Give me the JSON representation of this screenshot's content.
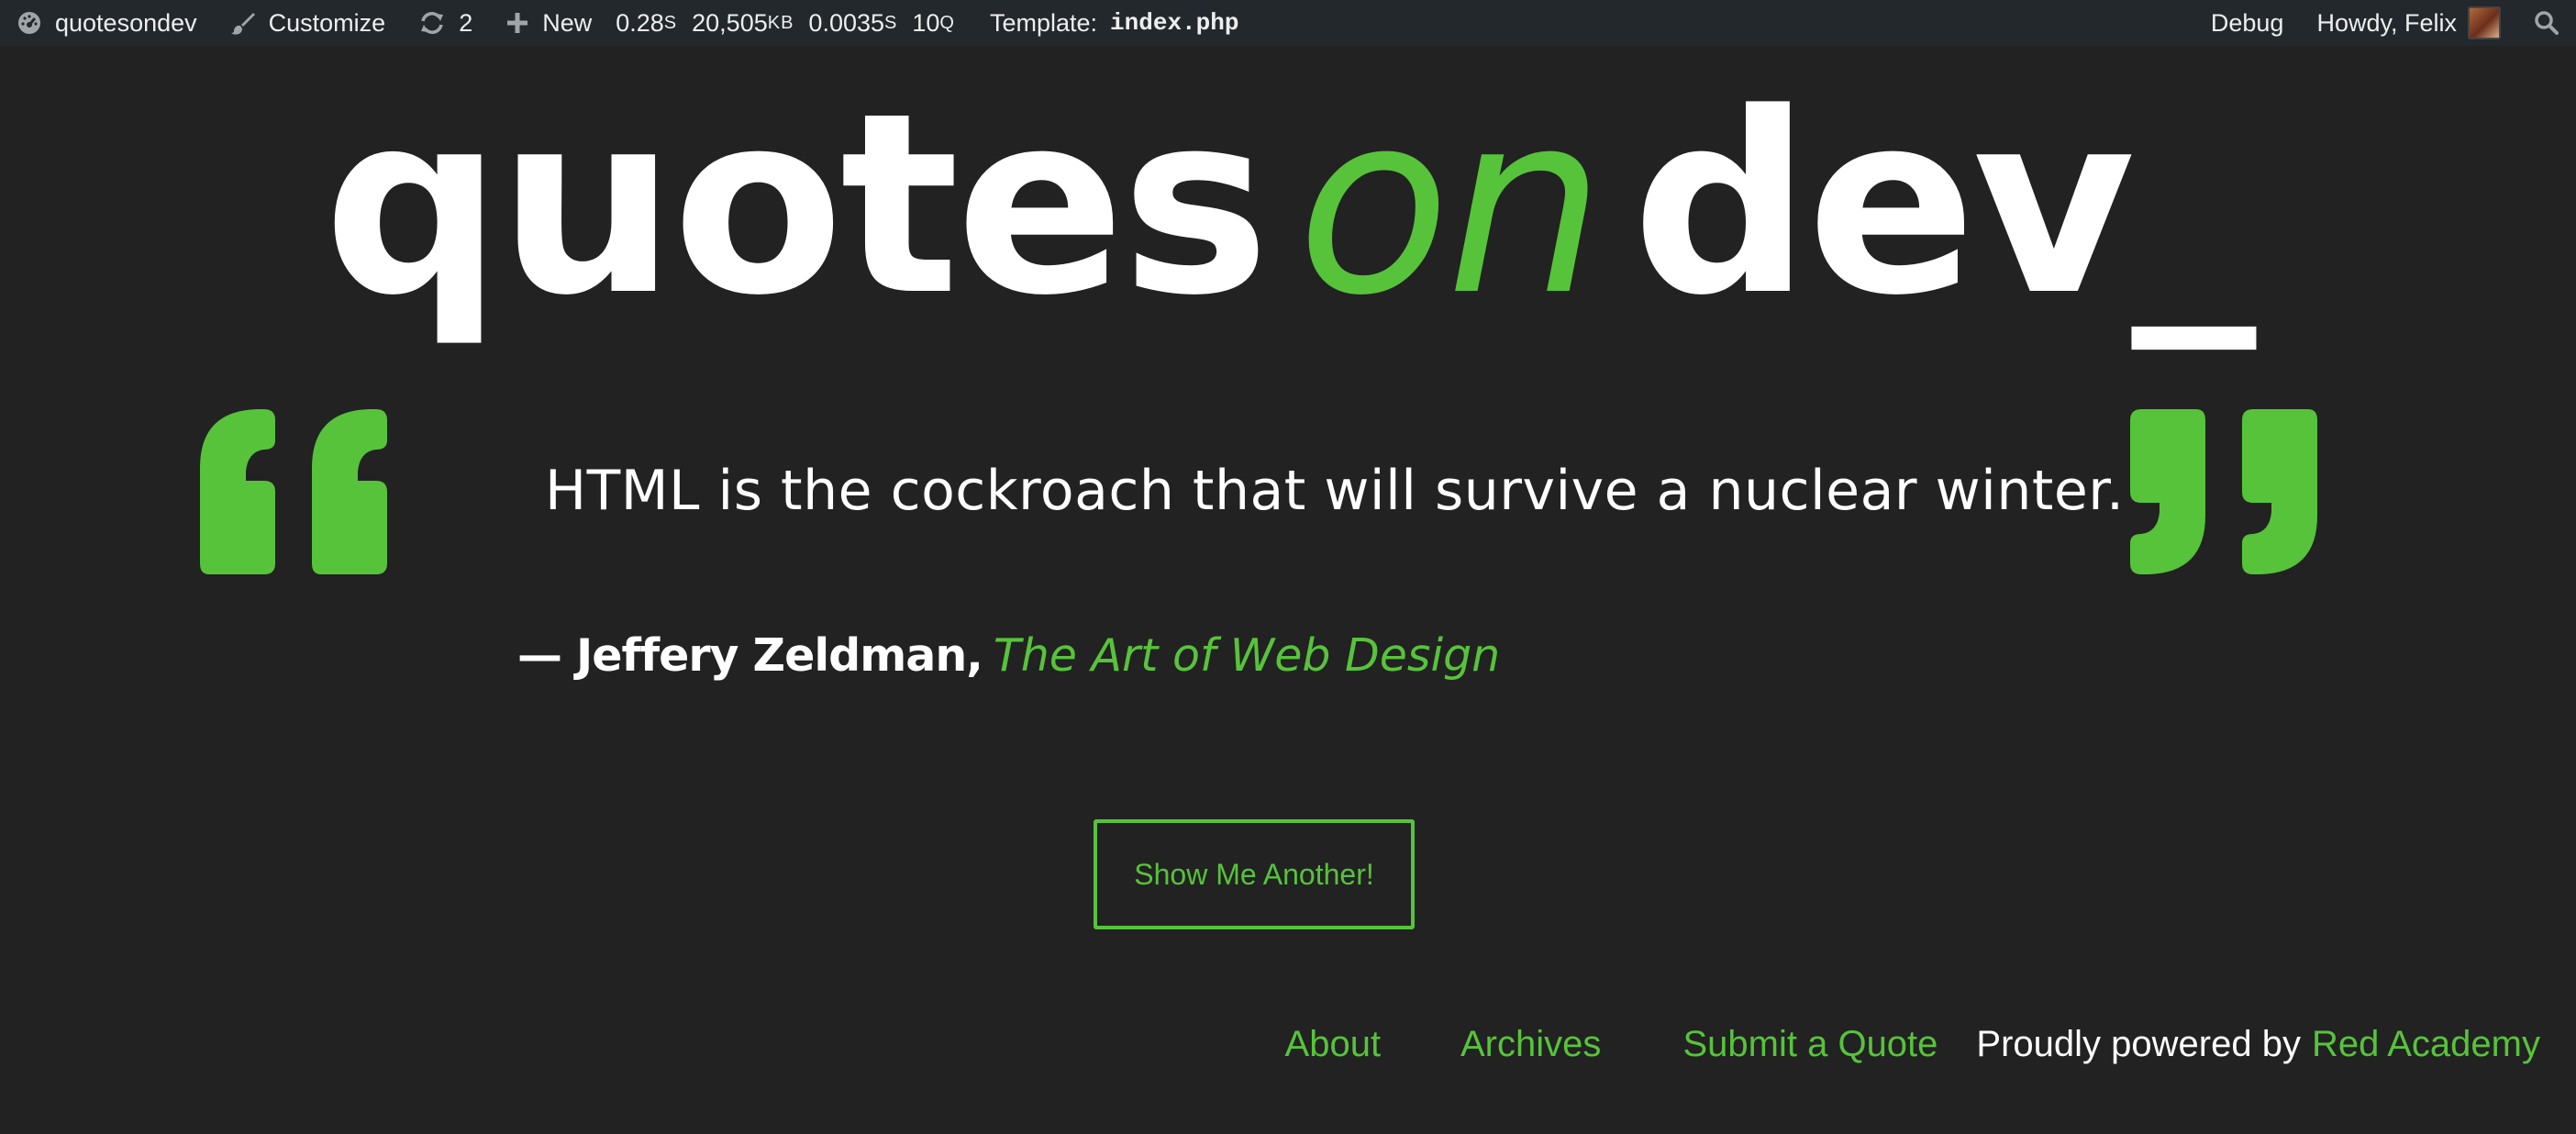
{
  "adminbar": {
    "site_name": "quotesondev",
    "customize_label": "Customize",
    "updates_count": "2",
    "new_label": "New",
    "stats": {
      "time_value": "0.28",
      "time_unit": "S",
      "memory_value": "20,505",
      "memory_unit": "KB",
      "query_time_value": "0.0035",
      "query_time_unit": "S",
      "queries_value": "10",
      "queries_unit": "Q"
    },
    "template_label": "Template:",
    "template_file": "index.php",
    "debug_label": "Debug",
    "greeting": "Howdy, Felix",
    "icons": [
      "dashboard-icon",
      "paintbrush-icon",
      "refresh-icon",
      "plus-icon",
      "search-icon"
    ]
  },
  "logo": {
    "word1": "quotes",
    "word2": "on",
    "word3": "dev_"
  },
  "quote": {
    "text": "HTML is the cockroach that will survive a nuclear winter.",
    "author": "— Jeffery Zeldman,",
    "source": "The Art of Web Design"
  },
  "button": {
    "label": "Show Me Another!"
  },
  "footer": {
    "nav": [
      "About",
      "Archives",
      "Submit a Quote"
    ],
    "powered_by": "Proudly powered by",
    "powered_link": "Red Academy"
  },
  "colors": {
    "background": "#222222",
    "adminbar": "#23282d",
    "accent": "#57c33b",
    "text": "#ffffff"
  }
}
